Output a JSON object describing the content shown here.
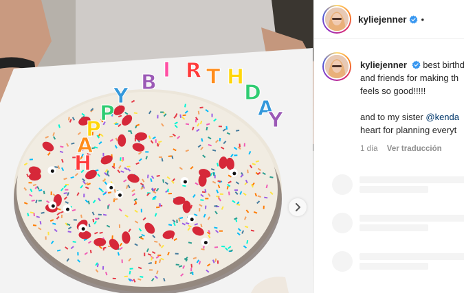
{
  "post": {
    "username": "kyliejenner",
    "separator": "•",
    "caption_lines": [
      "best birthd",
      "and friends for making th",
      "feels so good!!!!!"
    ],
    "caption_line4_prefix": "and to my sister ",
    "caption_mention": "@kenda",
    "caption_line5": "heart for planning everyt",
    "time_ago": "1 día",
    "translate_label": "Ver traducción"
  },
  "photo": {
    "candle_letters": [
      "H",
      "A",
      "P",
      "P",
      "Y",
      "B",
      "I",
      "R",
      "T",
      "H",
      "D",
      "A",
      "Y"
    ],
    "next_icon": "chevron-right-icon"
  },
  "icons": {
    "verified": "verified-badge-icon",
    "next": "chevron-right-icon"
  },
  "colors": {
    "verified_blue": "#3897f0",
    "mention_blue": "#00376b",
    "meta_grey": "#8e8e8e",
    "skeleton_grey": "#f4f4f4"
  },
  "comments_loading": [
    {},
    {},
    {}
  ]
}
